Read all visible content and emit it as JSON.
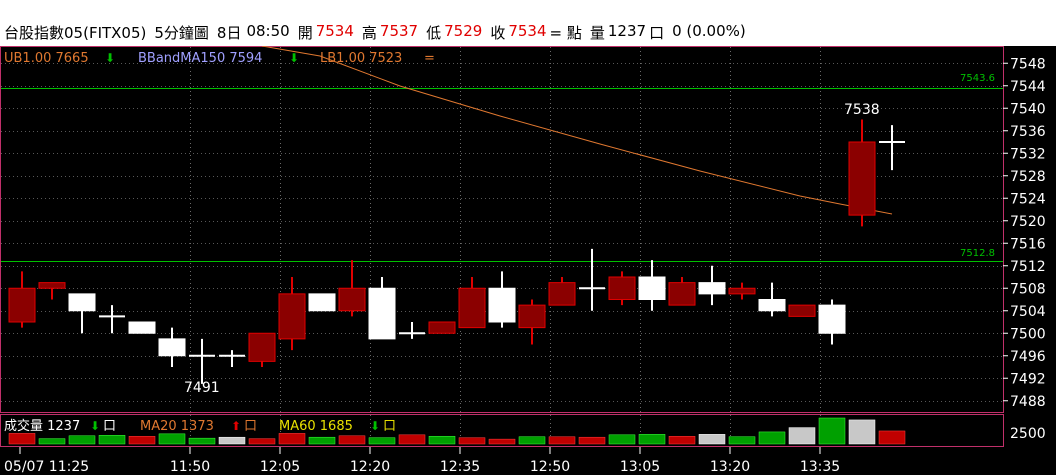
{
  "header": {
    "title": "台股指數05(FITX05)",
    "interval": "5分鐘圖",
    "date": "8日",
    "time": "08:50",
    "open_label": "開",
    "open": "7534",
    "high_label": "高",
    "high": "7537",
    "low_label": "低",
    "low": "7529",
    "close_label": "收",
    "close": "7534",
    "change": "= 點",
    "volume_label": "量",
    "volume": "1237",
    "box": "口",
    "change_pct": "0 (0.00%)"
  },
  "legend_top": {
    "ub": "UB1.00 7665",
    "bbma": "BBandMA150 7594",
    "lb": "LB1.00 7523",
    "eq": "="
  },
  "legend_volume": {
    "vol": "成交量 1237",
    "vol_unit": "口",
    "ma20": "MA20 1373",
    "ma20_unit": "口",
    "ma60": "MA60 1685",
    "ma60_unit": "口"
  },
  "annotations": {
    "high_mark": "7538",
    "low_mark": "7491",
    "hline1": "7543.6",
    "hline2": "7512.8"
  },
  "y_ticks": [
    "7548",
    "7544",
    "7540",
    "7536",
    "7532",
    "7528",
    "7524",
    "7520",
    "7516",
    "7512",
    "7508",
    "7504",
    "7500",
    "7496",
    "7492",
    "7488"
  ],
  "vol_tick": "2500",
  "x_ticks": [
    "05/07 11:25",
    "11:50",
    "12:05",
    "12:20",
    "12:35",
    "12:50",
    "13:05",
    "13:20",
    "13:35"
  ],
  "colors": {
    "up": "#8b0000",
    "down": "#ffffff",
    "grid": "#b0b0b0",
    "frame": "#c0306a",
    "bb_line": "#e07830",
    "level_line": "#00c000",
    "vol_red": "#c00000",
    "vol_green": "#00a000",
    "vol_gray": "#c8c8c8"
  },
  "chart_data": {
    "type": "candlestick",
    "candles": [
      {
        "o": 7502,
        "h": 7511,
        "l": 7501,
        "c": 7508
      },
      {
        "o": 7508,
        "h": 7509,
        "l": 7506,
        "c": 7509
      },
      {
        "o": 7507,
        "h": 7507,
        "l": 7500,
        "c": 7504
      },
      {
        "o": 7503,
        "h": 7505,
        "l": 7500,
        "c": 7503
      },
      {
        "o": 7502,
        "h": 7502,
        "l": 7500,
        "c": 7500
      },
      {
        "o": 7499,
        "h": 7501,
        "l": 7494,
        "c": 7496
      },
      {
        "o": 7496,
        "h": 7499,
        "l": 7491,
        "c": 7496
      },
      {
        "o": 7496,
        "h": 7497,
        "l": 7494,
        "c": 7496
      },
      {
        "o": 7495,
        "h": 7500,
        "l": 7494,
        "c": 7500
      },
      {
        "o": 7499,
        "h": 7510,
        "l": 7497,
        "c": 7507
      },
      {
        "o": 7507,
        "h": 7507,
        "l": 7504,
        "c": 7504
      },
      {
        "o": 7504,
        "h": 7513,
        "l": 7503,
        "c": 7508
      },
      {
        "o": 7508,
        "h": 7510,
        "l": 7499,
        "c": 7499
      },
      {
        "o": 7500,
        "h": 7502,
        "l": 7499,
        "c": 7500
      },
      {
        "o": 7500,
        "h": 7502,
        "l": 7500,
        "c": 7502
      },
      {
        "o": 7501,
        "h": 7510,
        "l": 7501,
        "c": 7508
      },
      {
        "o": 7508,
        "h": 7511,
        "l": 7501,
        "c": 7502
      },
      {
        "o": 7501,
        "h": 7506,
        "l": 7498,
        "c": 7505
      },
      {
        "o": 7505,
        "h": 7510,
        "l": 7505,
        "c": 7509
      },
      {
        "o": 7508,
        "h": 7515,
        "l": 7504,
        "c": 7508
      },
      {
        "o": 7506,
        "h": 7511,
        "l": 7505,
        "c": 7510
      },
      {
        "o": 7510,
        "h": 7513,
        "l": 7504,
        "c": 7506
      },
      {
        "o": 7505,
        "h": 7510,
        "l": 7505,
        "c": 7509
      },
      {
        "o": 7509,
        "h": 7512,
        "l": 7505,
        "c": 7507
      },
      {
        "o": 7507,
        "h": 7509,
        "l": 7506,
        "c": 7508
      },
      {
        "o": 7506,
        "h": 7509,
        "l": 7503,
        "c": 7504
      },
      {
        "o": 7503,
        "h": 7505,
        "l": 7503,
        "c": 7505
      },
      {
        "o": 7505,
        "h": 7506,
        "l": 7498,
        "c": 7500
      },
      {
        "o": 7521,
        "h": 7538,
        "l": 7519,
        "c": 7534
      },
      {
        "o": 7534,
        "h": 7537,
        "l": 7529,
        "c": 7534
      }
    ],
    "volume_colors": [
      "r",
      "g",
      "g",
      "g",
      "r",
      "g",
      "g",
      "w",
      "r",
      "r",
      "g",
      "r",
      "g",
      "r",
      "g",
      "r",
      "r",
      "g",
      "r",
      "r",
      "g",
      "g",
      "r",
      "w",
      "g",
      "g",
      "w",
      "g",
      "w",
      "r"
    ],
    "volume": [
      900,
      350,
      650,
      700,
      600,
      850,
      400,
      500,
      350,
      900,
      500,
      650,
      450,
      750,
      600,
      450,
      300,
      550,
      550,
      500,
      750,
      800,
      600,
      800,
      550,
      1050,
      1500,
      2500,
      2300,
      1150
    ]
  }
}
